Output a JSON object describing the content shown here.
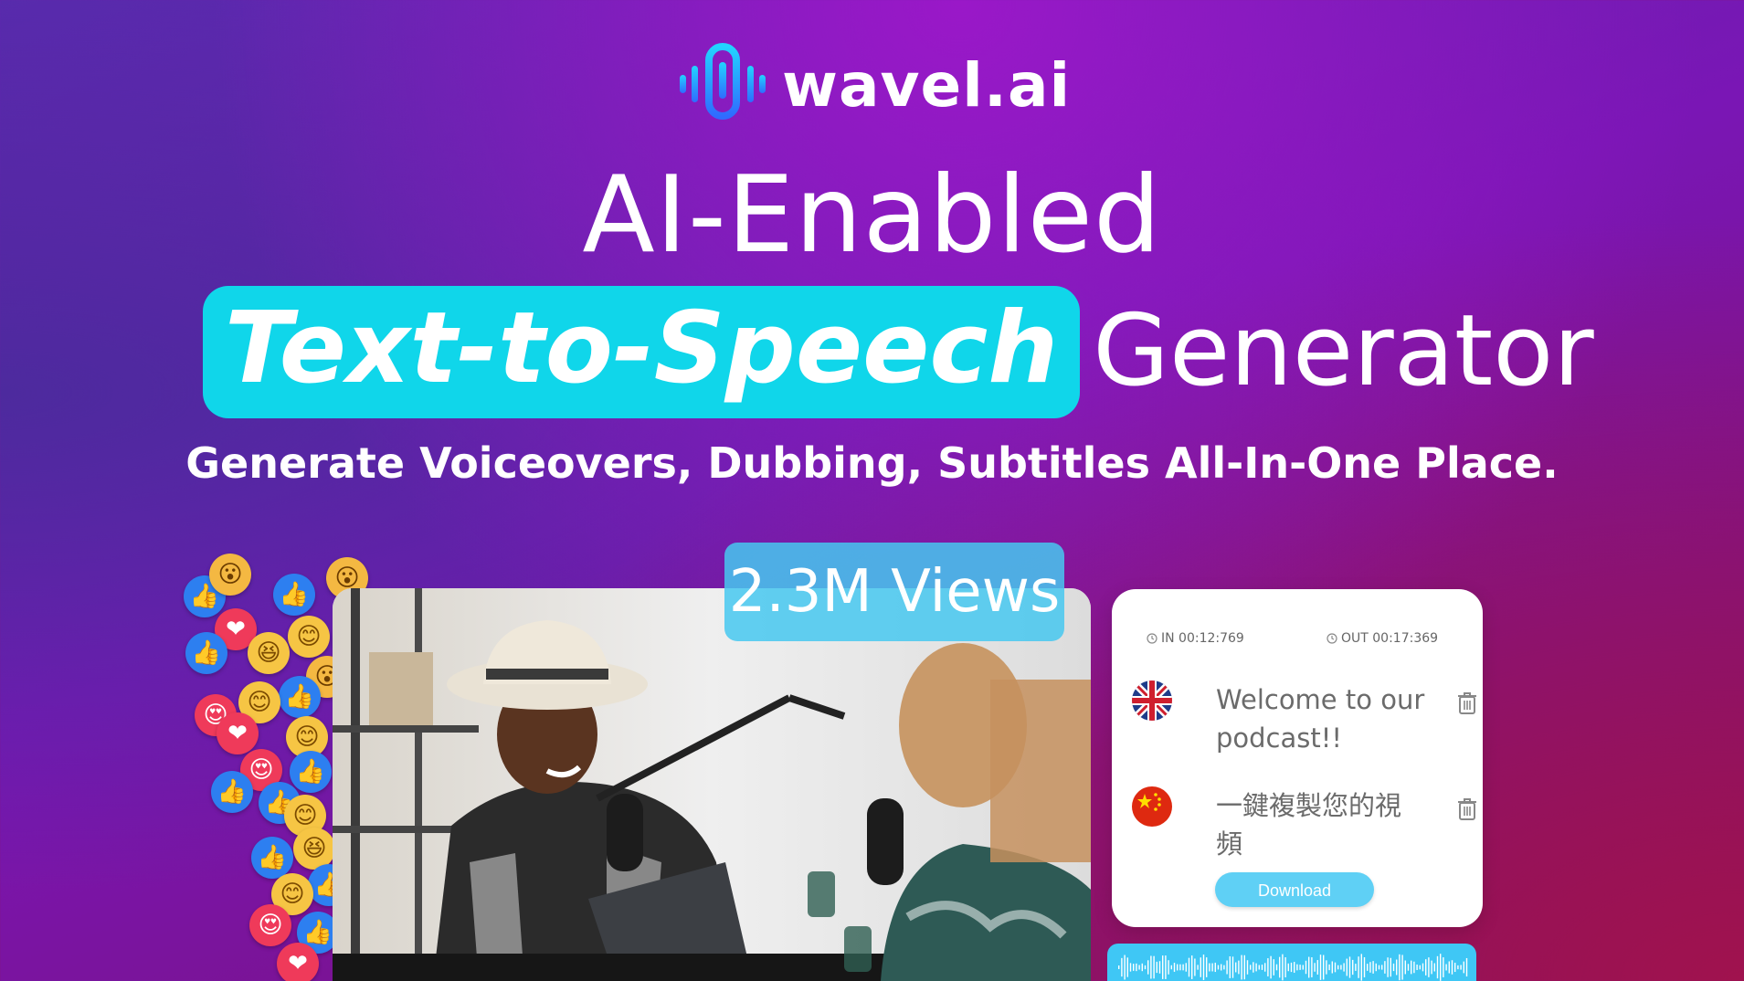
{
  "brand": {
    "name": "wavel.ai",
    "logo_icon": "soundwave-mic-icon",
    "logo_color": "#1aa3ff"
  },
  "hero": {
    "line1": "AI-Enabled",
    "highlight": "Text-to-Speech",
    "line2_rest": "Generator",
    "subtitle": "Generate Voiceovers, Dubbing, Subtitles All-In-One Place.",
    "highlight_color": "#10d6ea"
  },
  "views_badge": "2.3M Views",
  "translation_card": {
    "in_time": "IN 00:12:769",
    "out_time": "OUT 00:17:369",
    "rows": [
      {
        "flag": "uk-flag-icon",
        "text": "Welcome to our podcast!!"
      },
      {
        "flag": "china-flag-icon",
        "text": "一鍵複製您的視頻"
      }
    ],
    "download_label": "Download",
    "button_color": "#5fd0f5"
  },
  "waveform_color": "#3fc7f5"
}
